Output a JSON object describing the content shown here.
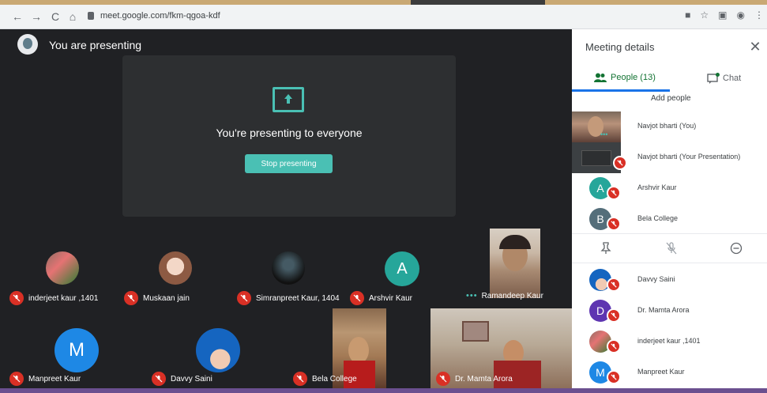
{
  "browser": {
    "url": "meet.google.com/fkm-qgoa-kdf",
    "nav_back": "←",
    "nav_forward": "→",
    "nav_reload": "C",
    "nav_home": "⌂"
  },
  "presenting": {
    "banner": "You are presenting",
    "title": "You're presenting to everyone",
    "stop_button": "Stop presenting"
  },
  "tiles": [
    {
      "name": "inderjeet kaur ,1401",
      "muted": true
    },
    {
      "name": "Muskaan jain",
      "muted": true
    },
    {
      "name": "Simranpreet Kaur, 1404",
      "muted": true
    },
    {
      "name": "Arshvir Kaur",
      "muted": true,
      "letter": "A",
      "color": "#26a69a"
    },
    {
      "name": "Ramandeep Kaur",
      "muted": false
    },
    {
      "name": "Manpreet Kaur",
      "muted": true,
      "letter": "M",
      "color": "#1e88e5"
    },
    {
      "name": "Davvy Saini",
      "muted": true
    },
    {
      "name": "Bela College",
      "muted": true
    },
    {
      "name": "Dr. Mamta Arora",
      "muted": true
    }
  ],
  "panel": {
    "title": "Meeting details",
    "tab_people": "People (13)",
    "tab_chat": "Chat",
    "add_people": "Add people",
    "people": [
      {
        "name": "Navjot bharti (You)"
      },
      {
        "name": "Navjot bharti (Your Presentation)"
      },
      {
        "name": "Arshvir Kaur",
        "letter": "A",
        "color": "#26a69a"
      },
      {
        "name": "Bela College",
        "letter": "B",
        "color": "#546e7a"
      },
      {
        "name": "Davvy Saini"
      },
      {
        "name": "Dr. Mamta Arora",
        "letter": "D",
        "color": "#5e35b1"
      },
      {
        "name": "inderjeet kaur ,1401"
      },
      {
        "name": "Manpreet Kaur",
        "letter": "M",
        "color": "#1e88e5"
      }
    ]
  },
  "colors": {
    "accent": "#4ac0b4",
    "mute": "#d93025",
    "people_tab": "#137333"
  }
}
